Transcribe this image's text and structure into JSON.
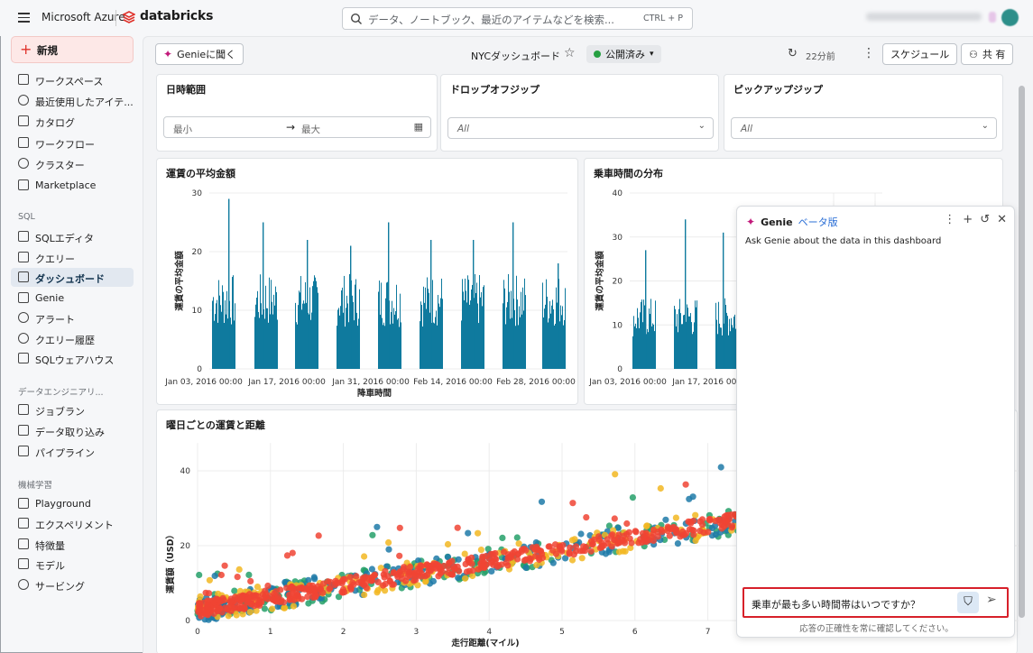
{
  "topbar": {
    "brand": "Microsoft Azure",
    "product": "databricks",
    "search_placeholder": "データ、ノートブック、最近のアイテムなどを検索...",
    "search_shortcut": "CTRL + P"
  },
  "sidebar": {
    "new_label": "新規",
    "items": [
      "ワークスペース",
      "最近使用したアイテ...",
      "カタログ",
      "ワークフロー",
      "クラスター",
      "Marketplace"
    ],
    "sql_header": "SQL",
    "sql_items": [
      "SQLエディタ",
      "クエリー",
      "ダッシュボード",
      "Genie",
      "アラート",
      "クエリー履歴",
      "SQLウェアハウス"
    ],
    "de_header": "データエンジニアリ...",
    "de_items": [
      "ジョブラン",
      "データ取り込み",
      "パイプライン"
    ],
    "ml_header": "機械学習",
    "ml_items": [
      "Playground",
      "エクスペリメント",
      "特徴量",
      "モデル",
      "サービング"
    ]
  },
  "toolbar": {
    "genie_btn": "Genieに聞く",
    "title": "NYCダッシュボード",
    "status": "公開済み",
    "updated": "22分前",
    "schedule": "スケジュール",
    "share": "共 有"
  },
  "filters": {
    "date": {
      "title": "日時範囲",
      "min": "最小",
      "max": "最大"
    },
    "dropoff": {
      "title": "ドロップオフジップ",
      "value": "All"
    },
    "pickup": {
      "title": "ピックアップジップ",
      "value": "All"
    }
  },
  "charts": {
    "avg_fare": {
      "title": "運賃の平均金額",
      "ylabel": "運賃の平均金額",
      "xlabel": "降車時間",
      "yticks": [
        "0",
        "10",
        "20",
        "30"
      ],
      "xticks": [
        "Jan 03, 2016 00:00",
        "Jan 17, 2016 00:00",
        "Jan 31, 2016 00:00",
        "Feb 14, 2016 00:00",
        "Feb 28, 2016 00:00"
      ]
    },
    "duration": {
      "title": "乗車時間の分布",
      "ylabel": "運賃の平均金額",
      "yticks": [
        "0",
        "10",
        "20",
        "30",
        "40"
      ],
      "xticks": [
        "Jan 03, 2016 00:00",
        "Jan 17, 2016 00:00"
      ]
    },
    "scatter": {
      "title": "曜日ごとの運賃と距離",
      "ylabel": "運賃額（USD）",
      "xlabel": "走行距離(マイル)",
      "yticks": [
        "0",
        "20",
        "40"
      ],
      "xticks": [
        "0",
        "1",
        "2",
        "3",
        "4",
        "5",
        "6",
        "7"
      ]
    }
  },
  "chart_data": [
    {
      "type": "bar",
      "title": "運賃の平均金額",
      "xlabel": "降車時間",
      "ylabel": "運賃の平均金額",
      "ylim": [
        0,
        30
      ],
      "weeks": [
        "Jan 03",
        "Jan 10",
        "Jan 17",
        "Jan 24",
        "Jan 31",
        "Feb 07",
        "Feb 14",
        "Feb 21",
        "Feb 28"
      ],
      "typical_values": [
        13,
        13,
        13,
        13,
        13,
        13,
        13,
        13,
        13
      ],
      "weekly_peaks": [
        29,
        25,
        22,
        21,
        25,
        22,
        22,
        25,
        18
      ],
      "color": "#0f7a9e"
    },
    {
      "type": "bar",
      "title": "乗車時間の分布",
      "ylabel": "運賃の平均金額",
      "ylim": [
        0,
        40
      ],
      "weeks": [
        "Jan 03",
        "Jan 10",
        "Jan 17",
        "Jan 24"
      ],
      "typical_values": [
        13,
        13,
        13,
        13
      ],
      "weekly_peaks": [
        27,
        34,
        31,
        25
      ],
      "color": "#0f7a9e"
    },
    {
      "type": "scatter",
      "title": "曜日ごとの運賃と距離",
      "xlabel": "走行距離(マイル)",
      "ylabel": "運賃額（USD）",
      "xlim": [
        0,
        7.5
      ],
      "ylim": [
        0,
        45
      ],
      "trend": {
        "intercept": 3,
        "slope": 3.2
      },
      "series_colors": [
        "#f04434",
        "#26a06a",
        "#1e7aa8",
        "#f2b722"
      ]
    }
  ],
  "genie": {
    "title": "Genie",
    "beta": "ベータ版",
    "hint": "Ask Genie about the data in this dashboard",
    "question": "乗車が最も多い時間帯はいつですか？",
    "footer": "応答の正確性を常に確認してください。"
  },
  "colors": {
    "accent": "#e0312a",
    "bar": "#0f7a9e",
    "highlight": "#d7202a"
  }
}
